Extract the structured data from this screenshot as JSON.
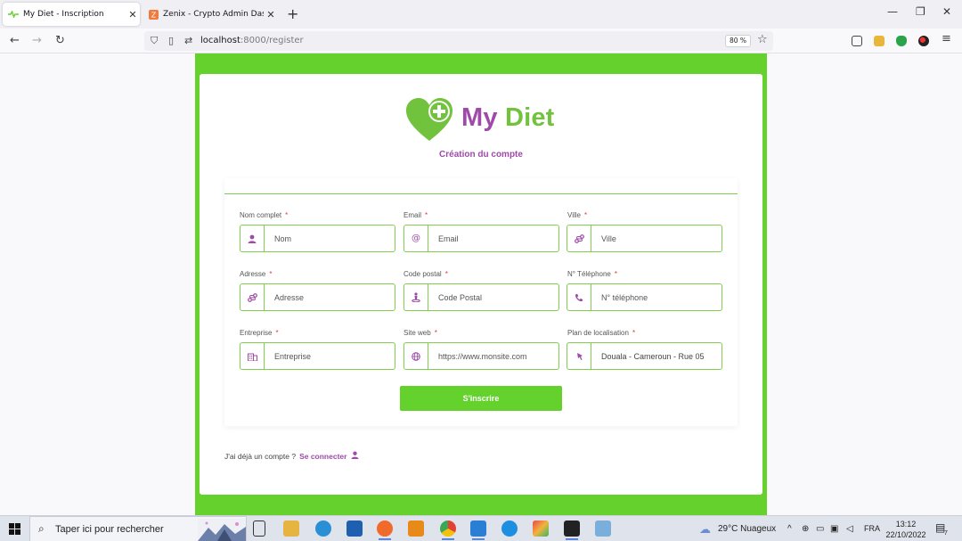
{
  "browser": {
    "tabs": [
      {
        "title": "My Diet - Inscription",
        "active": true
      },
      {
        "title": "Zenix - Crypto Admin Dashboa",
        "active": false
      }
    ],
    "new_tab_icon": "plus-icon",
    "url_host": "localhost",
    "url_path": ":8000/register",
    "zoom": "80 %"
  },
  "page": {
    "brand_my": "My",
    "brand_diet": "Diet",
    "subtitle": "Création du compte",
    "required_mark": "*",
    "fields": [
      {
        "label": "Nom complet",
        "placeholder": "Nom",
        "value": "",
        "icon": "user-icon"
      },
      {
        "label": "Email",
        "placeholder": "Email",
        "value": "",
        "icon": "at-icon"
      },
      {
        "label": "Ville",
        "placeholder": "Ville",
        "value": "",
        "icon": "route-icon"
      },
      {
        "label": "Adresse",
        "placeholder": "Adresse",
        "value": "",
        "icon": "route-icon"
      },
      {
        "label": "Code postal",
        "placeholder": "Code Postal",
        "value": "",
        "icon": "location-person-icon"
      },
      {
        "label": "N° Téléphone",
        "placeholder": "N° téléphone",
        "value": "",
        "icon": "phone-icon"
      },
      {
        "label": "Entreprise",
        "placeholder": "Entreprise",
        "value": "",
        "icon": "building-icon"
      },
      {
        "label": "Site web",
        "placeholder": "https://www.monsite.com",
        "value": "",
        "icon": "globe-icon"
      },
      {
        "label": "Plan de localisation",
        "placeholder": "",
        "value": "Douala - Cameroun - Rue 05",
        "icon": "map-marker-icon"
      }
    ],
    "submit_label": "S'inscrire",
    "login_prompt": "J'ai déjà un compte ?",
    "login_link": "Se connecter",
    "colors": {
      "green": "#64d12c",
      "purple": "#9f4aa9",
      "brand_green": "#71c23c"
    }
  },
  "taskbar": {
    "search_placeholder": "Taper ici pour rechercher",
    "weather": "29°C  Nuageux",
    "language": "FRA",
    "time": "13:12",
    "date": "22/10/2022",
    "notification_count": "7"
  }
}
